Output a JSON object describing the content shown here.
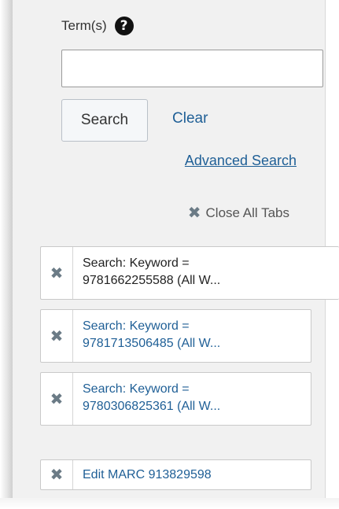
{
  "search": {
    "term_label": "Term(s)",
    "term_value": "",
    "search_label": "Search",
    "clear_label": "Clear",
    "advanced_label": "Advanced Search"
  },
  "tabs": {
    "close_all_label": "Close All Tabs",
    "items": [
      {
        "line1": "Search: Keyword =",
        "line2": "9781662255588 (All W..."
      },
      {
        "line1": "Search: Keyword =",
        "line2": "9781713506485 (All W..."
      },
      {
        "line1": "Search: Keyword =",
        "line2": "9780306825361 (All W..."
      },
      {
        "line1": "Edit MARC 913829598"
      }
    ]
  },
  "icons": {
    "help": "question-circle-icon",
    "close": "close-x-icon"
  },
  "colors": {
    "link": "#1f5f96",
    "panel_bg": "#f1f1f1",
    "x_icon": "#6b7b86"
  }
}
